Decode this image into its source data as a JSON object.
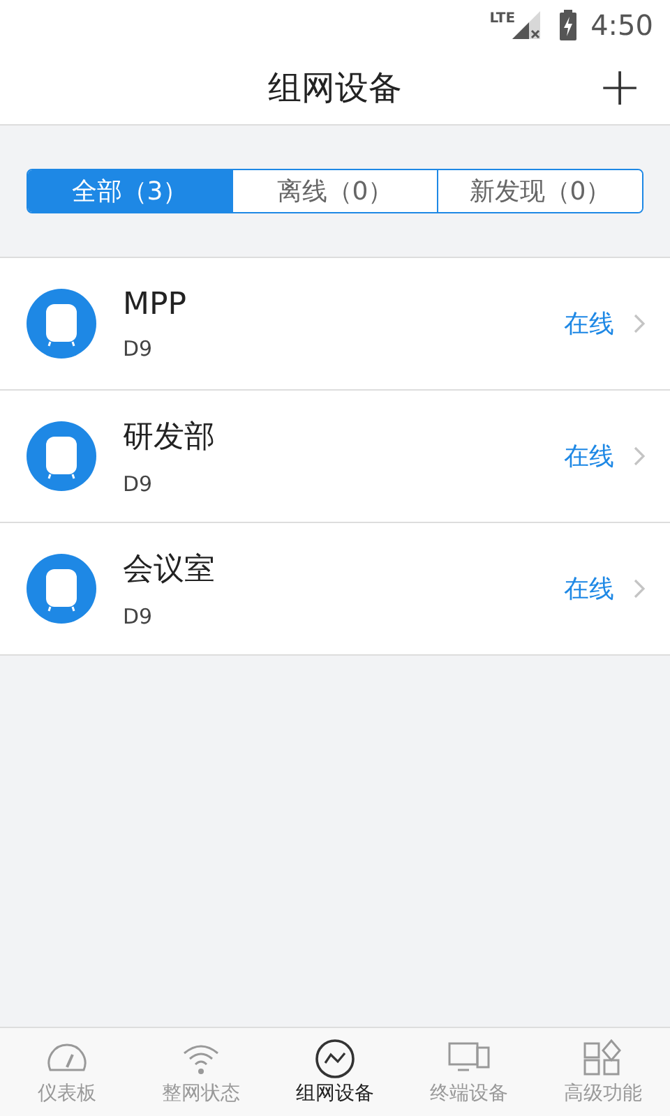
{
  "status_bar": {
    "network": "LTE",
    "time": "4:50"
  },
  "header": {
    "title": "组网设备",
    "add_button": "+"
  },
  "filter_tabs": [
    {
      "label": "全部（3）",
      "selected": true
    },
    {
      "label": "离线（0）",
      "selected": false
    },
    {
      "label": "新发现（0）",
      "selected": false
    }
  ],
  "devices": [
    {
      "name": "MPP",
      "model": "D9",
      "status": "在线"
    },
    {
      "name": "研发部",
      "model": "D9",
      "status": "在线"
    },
    {
      "name": "会议室",
      "model": "D9",
      "status": "在线"
    }
  ],
  "bottom_nav": [
    {
      "label": "仪表板",
      "selected": false
    },
    {
      "label": "整网状态",
      "selected": false
    },
    {
      "label": "组网设备",
      "selected": true
    },
    {
      "label": "终端设备",
      "selected": false
    },
    {
      "label": "高级功能",
      "selected": false
    }
  ]
}
